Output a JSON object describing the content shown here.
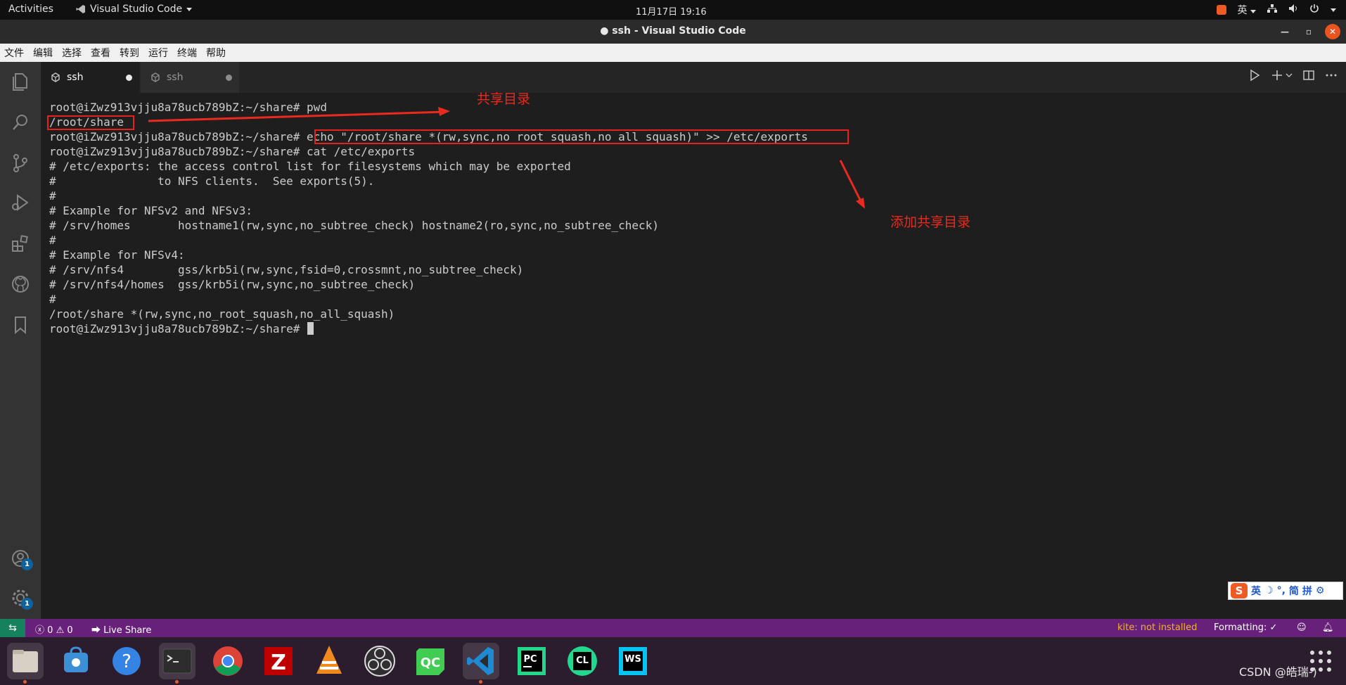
{
  "topbar": {
    "activities": "Activities",
    "app_name": "Visual Studio Code",
    "clock": "11月17日 19:16",
    "ime_lang": "英"
  },
  "window": {
    "title": "● ssh - Visual Studio Code"
  },
  "menu": [
    "文件",
    "编辑",
    "选择",
    "查看",
    "转到",
    "运行",
    "终端",
    "帮助"
  ],
  "activitybar": {
    "account_badge": "1",
    "settings_badge": "1"
  },
  "tabs": [
    {
      "label": "ssh",
      "active": true,
      "dirty": true
    },
    {
      "label": "ssh",
      "active": false,
      "dirty": true
    }
  ],
  "terminal": {
    "lines": [
      "root@iZwz913vjju8a78ucb789bZ:~/share# pwd",
      "/root/share",
      "root@iZwz913vjju8a78ucb789bZ:~/share# echo \"/root/share *(rw,sync,no_root_squash,no_all_squash)\" >> /etc/exports",
      "root@iZwz913vjju8a78ucb789bZ:~/share# cat /etc/exports",
      "# /etc/exports: the access control list for filesystems which may be exported",
      "#               to NFS clients.  See exports(5).",
      "#",
      "# Example for NFSv2 and NFSv3:",
      "# /srv/homes       hostname1(rw,sync,no_subtree_check) hostname2(ro,sync,no_subtree_check)",
      "#",
      "# Example for NFSv4:",
      "# /srv/nfs4        gss/krb5i(rw,sync,fsid=0,crossmnt,no_subtree_check)",
      "# /srv/nfs4/homes  gss/krb5i(rw,sync,no_subtree_check)",
      "#",
      "/root/share *(rw,sync,no_root_squash,no_all_squash)",
      "root@iZwz913vjju8a78ucb789bZ:~/share# "
    ],
    "annotations": {
      "shared_dir": "共享目录",
      "add_shared_dir": "添加共享目录"
    }
  },
  "ime_bar": {
    "lang": "英",
    "mode1": "简",
    "mode2": "拼"
  },
  "statusbar": {
    "errors": "0",
    "warnings": "0",
    "live_share": "Live Share",
    "kite": "kite: not installed",
    "formatting": "Formatting: ✓"
  },
  "dock": {
    "apps": [
      "files",
      "software",
      "help",
      "terminal",
      "chrome",
      "filezilla",
      "vlc",
      "obs",
      "qtcreator",
      "vscode",
      "pycharm",
      "clion",
      "webstorm"
    ],
    "watermark": "CSDN @皓瑞-)"
  },
  "colors": {
    "statusbar": "#68217a",
    "annotation_red": "#ea2a1f",
    "terminal_bg": "#1e1e1e",
    "terminal_fg": "#cccccc"
  }
}
